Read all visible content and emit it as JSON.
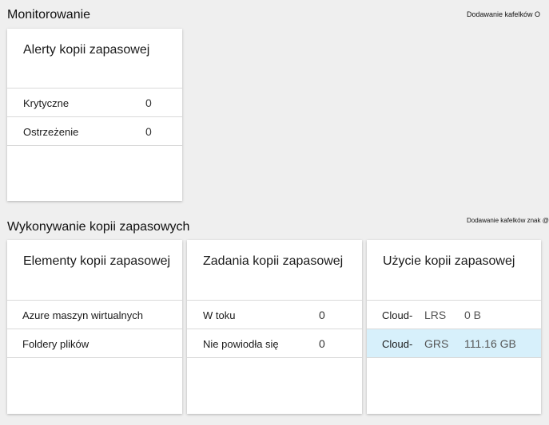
{
  "monitoring": {
    "title": "Monitorowanie",
    "add_tiles": "Dodawanie kafelków O",
    "alerts_card": {
      "title": "Alerty kopii zapasowej",
      "rows": [
        {
          "label": "Krytyczne",
          "value": "0"
        },
        {
          "label": "Ostrzeżenie",
          "value": "0"
        }
      ]
    }
  },
  "backup": {
    "title": "Wykonywanie kopii zapasowych",
    "add_tiles": "Dodawanie kafelków znak @",
    "items_card": {
      "title": "Elementy kopii zapasowej",
      "rows": [
        {
          "label": "Azure maszyn wirtualnych"
        },
        {
          "label": "Foldery plików"
        }
      ]
    },
    "jobs_card": {
      "title": "Zadania kopii zapasowej",
      "rows": [
        {
          "label": "W toku",
          "value": "0"
        },
        {
          "label": "Nie powiodła się",
          "value": "0"
        }
      ]
    },
    "usage_card": {
      "title": "Użycie kopii zapasowej",
      "rows": [
        {
          "label": "Cloud-",
          "type": "LRS",
          "value": "0 B"
        },
        {
          "label": "Cloud-",
          "type": "GRS",
          "value": "111.16 GB"
        }
      ]
    }
  },
  "colors": {
    "background": "#efefef",
    "card": "#ffffff",
    "selected_row": "#d7f0fb"
  }
}
